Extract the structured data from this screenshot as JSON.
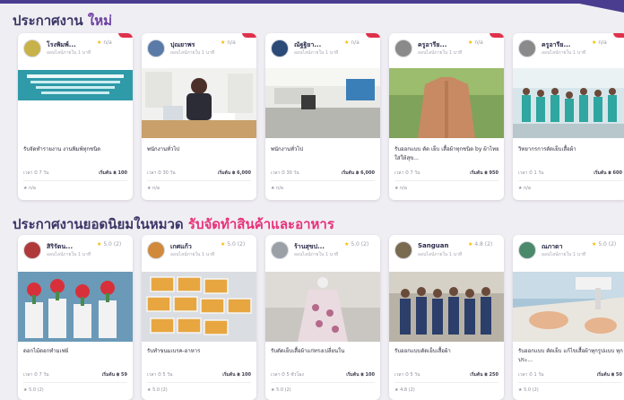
{
  "section1": {
    "title_plain": "ประกาศงาน",
    "title_accent": "ใหม่"
  },
  "section2": {
    "title_plain": "ประกาศงานยอดนิยมในหมวด",
    "title_accent": "รับจัดทำสินค้าและอาหาร"
  },
  "badge_label": "new",
  "row1": [
    {
      "seller": "โรงพิมพ์...",
      "rating": "n/a",
      "seller_sub": "ออนไลน์ภายใน 1 นาที",
      "title": "รับจัดทำรายงาน งานพิมพ์ทุกชนิด",
      "time": "เวลา ⏱ 7 วัน",
      "price": "เริ่มต้น ฿ 100",
      "footer": "★ n/a",
      "avatar_color": "#c7b24a",
      "thumb": "doc-screen"
    },
    {
      "seller": "ปุณยาพร",
      "rating": "n/a",
      "seller_sub": "ออนไลน์ภายใน 1 นาที",
      "title": "พนักงานทั่วไป",
      "time": "เวลา ⏱ 30 วัน",
      "price": "เริ่มต้น ฿ 6,000",
      "footer": "★ n/a",
      "avatar_color": "#5a7aa8",
      "thumb": "office-woman"
    },
    {
      "seller": "ณัฐฐิยา...",
      "rating": "n/a",
      "seller_sub": "ออนไลน์ภายใน 1 นาที",
      "title": "พนักงานทั่วไป",
      "time": "เวลา ⏱ 30 วัน",
      "price": "เริ่มต้น ฿ 6,000",
      "footer": "★ n/a",
      "avatar_color": "#2c4a78",
      "thumb": "office-room"
    },
    {
      "seller": "ครูอารีย...",
      "rating": "n/a",
      "seller_sub": "ออนไลน์ภายใน 1 นาที",
      "title": "รับออกแบบ ตัด เย็บ เสื้อผ้าทุกชนิด by ผ้าไทยใส่ให้สุข...",
      "time": "เวลา ⏱ 7 วัน",
      "price": "เริ่มต้น ฿ 950",
      "footer": "★ n/a",
      "avatar_color": "#8a8a8a",
      "thumb": "shirt"
    },
    {
      "seller": "ครูอารีย...",
      "rating": "n/a",
      "seller_sub": "ออนไลน์ภายใน 1 นาที",
      "title": "วิทยากรการตัดเย็บเสื้อผ้า",
      "time": "เวลา ⏱ 1 วัน",
      "price": "เริ่มต้น ฿ 600",
      "footer": "★ n/a",
      "avatar_color": "#8a8a8a",
      "thumb": "class"
    }
  ],
  "row2": [
    {
      "seller": "สิริรัตน...",
      "rating": "5.0 (2)",
      "seller_sub": "ออนไลน์ภายใน 1 นาที",
      "title": "ดอกไม้ดอกทำมเฟย์",
      "time": "เวลา ⏱ 7 วัน",
      "price": "เริ่มต้น ฿ 59",
      "footer": "★ 5.0 (2)",
      "avatar_color": "#b03a3a",
      "thumb": "flowers"
    },
    {
      "seller": "เกศแก้ว",
      "rating": "5.0 (2)",
      "seller_sub": "ออนไลน์ภายใน 1 นาที",
      "title": "รับทำขนมเบรค-อาหาร",
      "time": "เวลา ⏱ 5 วัน",
      "price": "เริ่มต้น ฿ 100",
      "footer": "★ 5.0 (2)",
      "avatar_color": "#d18a3c",
      "thumb": "snack-boxes"
    },
    {
      "seller": "ร้านสุขป...",
      "rating": "5.0 (2)",
      "seller_sub": "ออนไลน์ภายใน 1 นาที",
      "title": "รับตัดเย็บเสื้อผ้าแก่ทรงเปลี่ยนใน",
      "time": "เวลา ⏱ 5 ชั่วโมง",
      "price": "เริ่มต้น ฿ 100",
      "footer": "★ 5.0 (2)",
      "avatar_color": "#9aa0a6",
      "thumb": "dress"
    },
    {
      "seller": "Sanguan",
      "rating": "4.8 (2)",
      "seller_sub": "ออนไลน์ภายใน 1 นาที",
      "title": "รับออกแบบตัดเย็บเสื้อผ้า",
      "time": "เวลา ⏱ 5 วัน",
      "price": "เริ่มต้น ฿ 250",
      "footer": "★ 4.8 (2)",
      "avatar_color": "#7a6a50",
      "thumb": "group"
    },
    {
      "seller": "ณภาดา",
      "rating": "5.0 (2)",
      "seller_sub": "ออนไลน์ภายใน 1 นาที",
      "title": "รับออกแบบ ตัดเย็บ แก้ไขเสื้อผ้าทุกรูปแบบ ทุกประ...",
      "time": "เวลา ⏱ 1 วัน",
      "price": "เริ่มต้น ฿ 50",
      "footer": "★ 5.0 (2)",
      "avatar_color": "#4a8a6a",
      "thumb": "sewing"
    }
  ],
  "colors": {
    "brand": "#4a3d8f",
    "accent_pink": "#e8317a",
    "accent_purple": "#6b3fa0",
    "badge_red": "#e0314b",
    "star": "#f5b800"
  }
}
